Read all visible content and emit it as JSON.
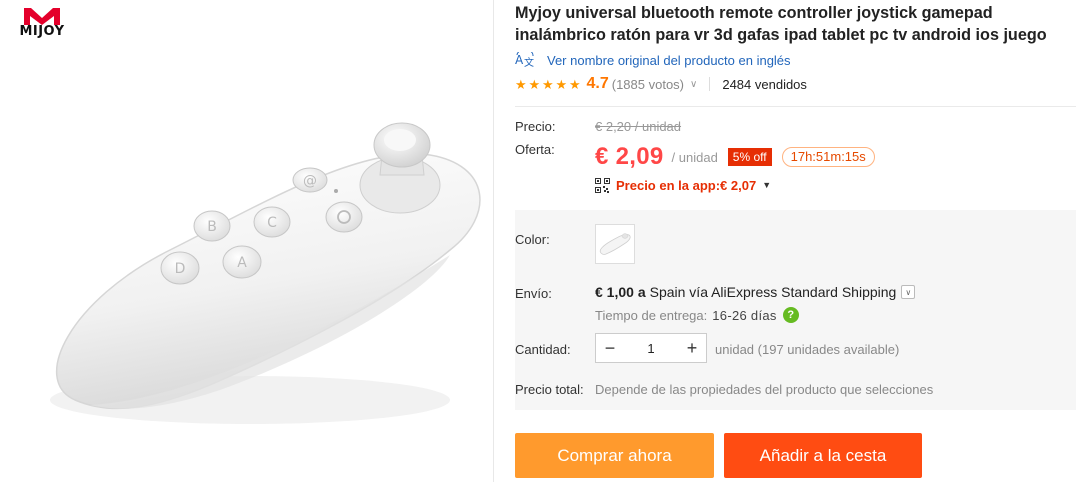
{
  "brand": {
    "logo_text": "MIJOY",
    "logo_color": "#e4002b"
  },
  "product": {
    "title": "Myjoy universal bluetooth remote controller joystick gamepad inalámbrico ratón para vr 3d gafas ipad tablet pc tv android ios juego",
    "translate_link": "Ver nombre original del producto en inglés",
    "photo_button_labels": [
      "@",
      "B",
      "C",
      "A",
      "D"
    ]
  },
  "rating": {
    "stars": 5,
    "value": "4.7",
    "votes": "(1885 votos)",
    "sold": "2484 vendidos"
  },
  "price": {
    "price_label": "Precio:",
    "old_price": "€ 2,20 / unidad",
    "offer_label": "Oferta:",
    "sale_price": "€ 2,09",
    "unit": "/ unidad",
    "discount": "5% off",
    "timer": "17h:51m:15s",
    "app_price": "Precio en la app:€ 2,07"
  },
  "options": {
    "color_label": "Color:",
    "shipping_label": "Envío:",
    "shipping_cost": "€ 1,00 a",
    "shipping_detail": "Spain vía AliExpress Standard Shipping",
    "delivery_label": "Tiempo de entrega:",
    "delivery_days": "16-26 días",
    "quantity_label": "Cantidad:",
    "quantity_value": "1",
    "quantity_minus": "−",
    "quantity_plus": "+",
    "quantity_note": "unidad (197 unidades available)",
    "total_label": "Precio total:",
    "total_note": "Depende de las propiedades del producto que selecciones"
  },
  "actions": {
    "buy_now": "Comprar ahora",
    "add_to_cart": "Añadir a la cesta"
  },
  "colors": {
    "accent_orange": "#ff9a2d",
    "accent_red": "#ff4c12",
    "price_red": "#ff4747",
    "link_blue": "#2266bb",
    "star_orange": "#ff9900"
  },
  "icons": {
    "translate": "translate-icon",
    "qr": "qr-code-icon",
    "help": "question-icon",
    "chevron": "chevron-down-icon"
  }
}
